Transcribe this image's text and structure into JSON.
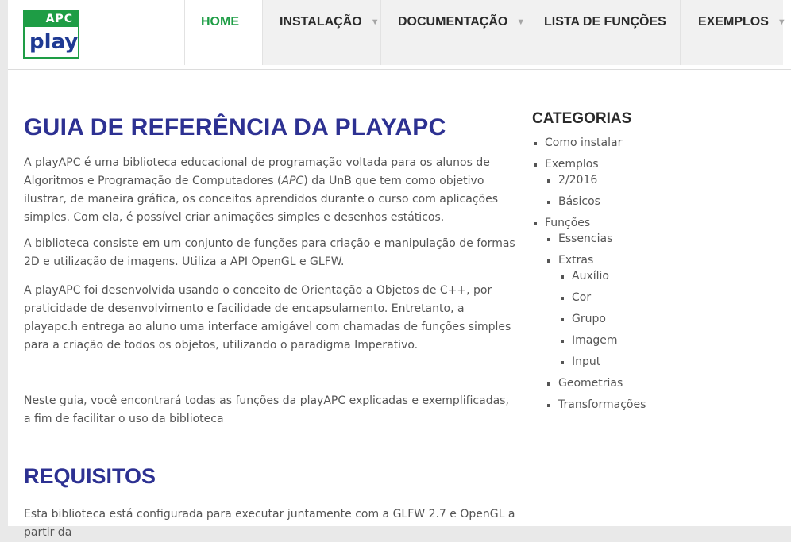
{
  "logo": {
    "apc": "APC",
    "play": "play"
  },
  "nav": {
    "items": [
      {
        "label": "HOME",
        "caret": ""
      },
      {
        "label": "INSTALAÇÃO",
        "caret": "▼"
      },
      {
        "label": "DOCUMENTAÇÃO",
        "caret": "▼"
      },
      {
        "label": "LISTA DE FUNÇÕES",
        "caret": ""
      },
      {
        "label": "EXEMPLOS",
        "caret": "▼"
      }
    ]
  },
  "main": {
    "title": "GUIA DE REFERÊNCIA DA PLAYAPC",
    "p1_a": "A playAPC é uma biblioteca educacional de programação voltada para os alunos de Algoritmos e Programação de Computadores (",
    "p1_em": "APC",
    "p1_b": ") da UnB que tem como objetivo ilustrar, de maneira gráfica, os conceitos aprendidos durante o curso com aplicações simples. Com ela, é possível criar animações simples e desenhos estáticos.",
    "p2": "A biblioteca consiste em um conjunto de funções para criação e manipulação de formas 2D e utilização de imagens. Utiliza a API OpenGL e GLFW.",
    "p3": "A playAPC foi desenvolvida usando o conceito de Orientação a Objetos de C++, por praticidade de desenvolvimento e facilidade de encapsulamento. Entretanto, a playapc.h entrega ao aluno uma interface amigável com chamadas de funções simples para a criação de todos os objetos, utilizando o paradigma Imperativo.",
    "p4": "Neste guia, você encontrará todas as funções da playAPC explicadas e exemplificadas, a fim de facilitar o uso da biblioteca",
    "requisitos_title": "REQUISITOS",
    "p5": "Esta biblioteca está configurada para executar juntamente com a GLFW 2.7 e OpenGL a partir da"
  },
  "sidebar": {
    "title": "CATEGORIAS",
    "items": [
      {
        "label": "Como instalar",
        "level": 0
      },
      {
        "label": "Exemplos",
        "level": 0
      },
      {
        "label": "2/2016",
        "level": 1
      },
      {
        "label": "Básicos",
        "level": 1
      },
      {
        "label": "Funções",
        "level": 0
      },
      {
        "label": "Essencias",
        "level": 1
      },
      {
        "label": "Extras",
        "level": 1
      },
      {
        "label": "Auxílio",
        "level": 2
      },
      {
        "label": "Cor",
        "level": 2
      },
      {
        "label": "Grupo",
        "level": 2
      },
      {
        "label": "Imagem",
        "level": 2
      },
      {
        "label": "Input",
        "level": 2
      },
      {
        "label": "Geometrias",
        "level": 1
      },
      {
        "label": "Transformações",
        "level": 1
      }
    ]
  },
  "colors": {
    "accent": "#1e9d45",
    "title": "#2d3192"
  }
}
